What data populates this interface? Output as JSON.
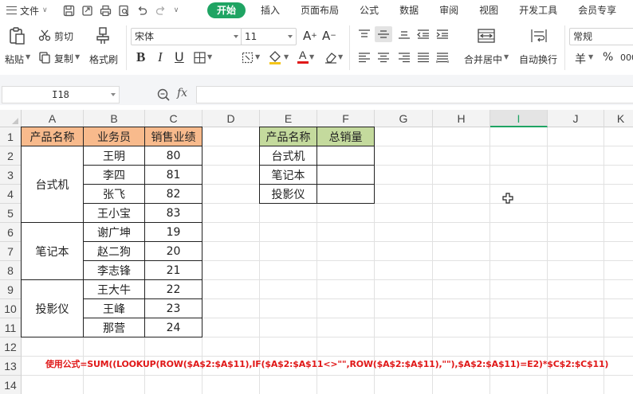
{
  "menubar": {
    "file_label": "文件",
    "tabs": [
      {
        "label": "开始",
        "active": true
      },
      {
        "label": "插入",
        "active": false
      },
      {
        "label": "页面布局",
        "active": false
      },
      {
        "label": "公式",
        "active": false
      },
      {
        "label": "数据",
        "active": false
      },
      {
        "label": "审阅",
        "active": false
      },
      {
        "label": "视图",
        "active": false
      },
      {
        "label": "开发工具",
        "active": false
      },
      {
        "label": "会员专享",
        "active": false
      }
    ]
  },
  "ribbon": {
    "paste_label": "粘贴",
    "cut_label": "剪切",
    "copy_label": "复制",
    "format_painter_label": "格式刷",
    "font_name": "宋体",
    "font_size": "11",
    "merge_center_label": "合并居中",
    "wrap_text_label": "自动换行",
    "number_format": "常规",
    "currency_symbol": "羊",
    "percent_symbol": "%",
    "thousands_symbol": "000"
  },
  "formula_bar": {
    "cell_ref": "I18",
    "fx_label": "fx",
    "value": ""
  },
  "sheet": {
    "columns": [
      "A",
      "B",
      "C",
      "D",
      "E",
      "F",
      "G",
      "H",
      "I",
      "J",
      "K"
    ],
    "rows": [
      "1",
      "2",
      "3",
      "4",
      "5",
      "6",
      "7",
      "8",
      "9",
      "10",
      "11",
      "12",
      "13",
      "14"
    ],
    "selected_column": "I",
    "table1": {
      "headers": [
        "产品名称",
        "业务员",
        "销售业绩"
      ],
      "groups": [
        {
          "product": "台式机",
          "rows": [
            [
              "王明",
              "80"
            ],
            [
              "李四",
              "81"
            ],
            [
              "张飞",
              "82"
            ],
            [
              "王小宝",
              "83"
            ]
          ]
        },
        {
          "product": "笔记本",
          "rows": [
            [
              "谢广坤",
              "19"
            ],
            [
              "赵二狗",
              "20"
            ],
            [
              "李志锋",
              "21"
            ]
          ]
        },
        {
          "product": "投影仪",
          "rows": [
            [
              "王大牛",
              "22"
            ],
            [
              "王峰",
              "23"
            ],
            [
              "那营",
              "24"
            ]
          ]
        }
      ]
    },
    "table2": {
      "headers": [
        "产品名称",
        "总销量"
      ],
      "rows": [
        [
          "台式机",
          ""
        ],
        [
          "笔记本",
          ""
        ],
        [
          "投影仪",
          ""
        ]
      ]
    },
    "note": "使用公式=SUM((LOOKUP(ROW($A$2:$A$11),IF($A$2:$A$11<>\"\",ROW($A$2:$A$11),\"\"),$A$2:$A$11)=E2)*$C$2:$C$11)"
  },
  "colors": {
    "accent_green": "#1fa463",
    "header_orange": "#f8ba8c",
    "header_green": "#c4da9d",
    "note_red": "#e01818"
  }
}
